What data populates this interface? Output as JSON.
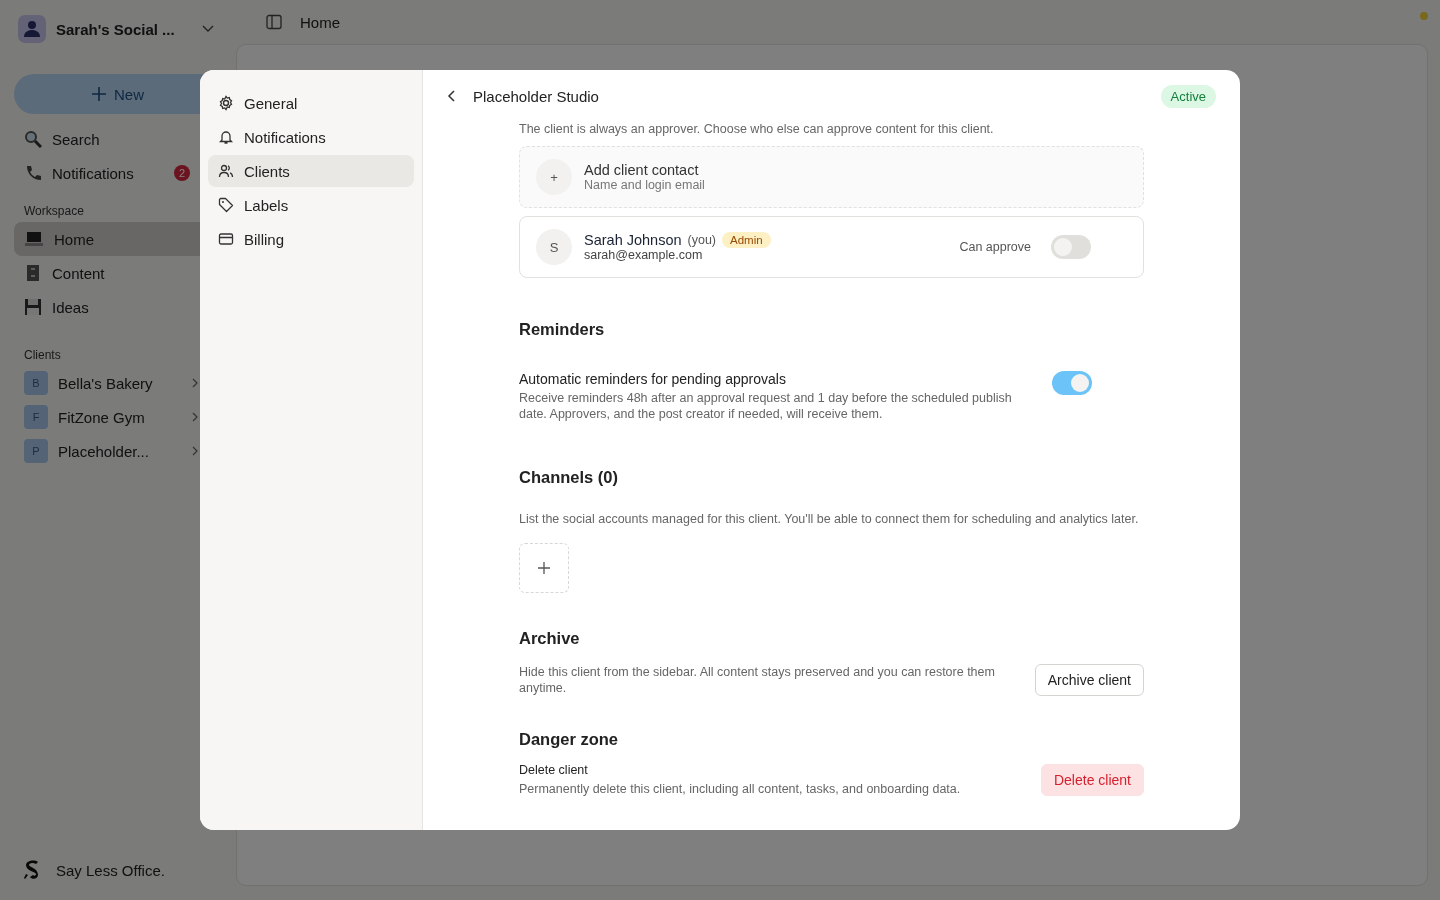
{
  "workspace": {
    "name": "Sarah's Social ..."
  },
  "topbar": {
    "title": "Home"
  },
  "sidebar": {
    "new_button": "New",
    "nav": [
      {
        "label": "Search",
        "kind": "search"
      },
      {
        "label": "Notifications",
        "kind": "phone",
        "badge": "2"
      }
    ],
    "workspace_heading": "Workspace",
    "workspace_items": [
      {
        "label": "Home",
        "kind": "laptop",
        "selected": true
      },
      {
        "label": "Content",
        "kind": "cabinet",
        "selected": false
      },
      {
        "label": "Ideas",
        "kind": "disk",
        "selected": false
      }
    ],
    "clients_heading": "Clients",
    "clients": [
      {
        "initial": "B",
        "name": "Bella's Bakery"
      },
      {
        "initial": "F",
        "name": "FitZone Gym"
      },
      {
        "initial": "P",
        "name": "Placeholder..."
      }
    ],
    "footer": "Say Less Office."
  },
  "settings": {
    "nav": [
      {
        "label": "General",
        "kind": "gear",
        "selected": false
      },
      {
        "label": "Notifications",
        "kind": "bell",
        "selected": false
      },
      {
        "label": "Clients",
        "kind": "users",
        "selected": true
      },
      {
        "label": "Labels",
        "kind": "tag",
        "selected": false
      },
      {
        "label": "Billing",
        "kind": "card",
        "selected": false
      }
    ],
    "header": {
      "title": "Placeholder Studio",
      "status": "Active"
    },
    "approvers": {
      "note": "The client is always an approver. Choose who else can approve content for this client.",
      "add_contact": {
        "icon": "+",
        "title": "Add client contact",
        "subtitle": "Name and login email"
      },
      "contacts": [
        {
          "initial": "S",
          "name": "Sarah Johnson",
          "you": "(you)",
          "role": "Admin",
          "email": "sarah@example.com",
          "approve_label": "Can approve",
          "can_approve": false
        }
      ]
    },
    "reminders": {
      "heading": "Reminders",
      "title": "Automatic reminders for pending approvals",
      "description": "Receive reminders 48h after an approval request and 1 day before the scheduled publish date. Approvers, and the post creator if needed, will receive them.",
      "on": true
    },
    "channels": {
      "heading": "Channels (0)",
      "description": "List the social accounts managed for this client. You'll be able to connect them for scheduling and analytics later."
    },
    "archive": {
      "heading": "Archive",
      "description": "Hide this client from the sidebar. All content stays preserved and you can restore them anytime.",
      "button": "Archive client"
    },
    "danger": {
      "heading": "Danger zone",
      "title": "Delete client",
      "description": "Permanently delete this client, including all content, tasks, and onboarding data.",
      "button": "Delete client"
    }
  }
}
